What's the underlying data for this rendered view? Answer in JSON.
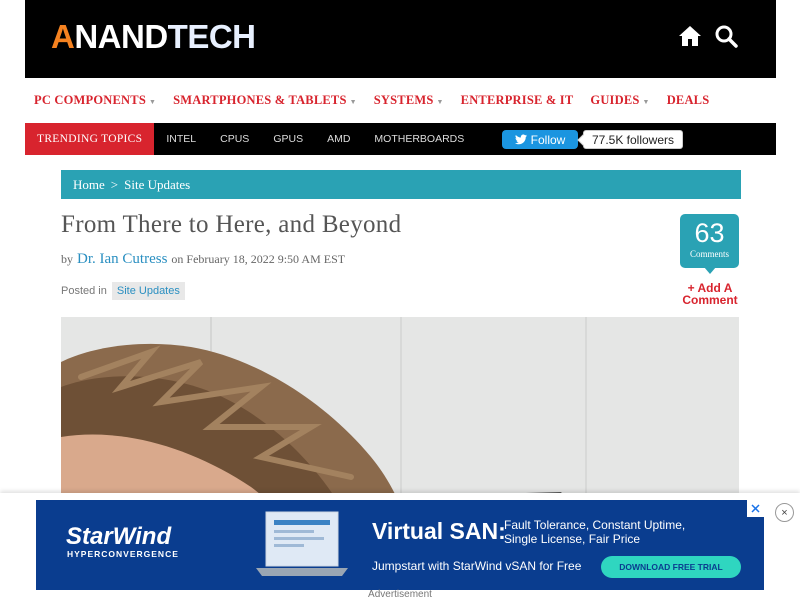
{
  "header": {
    "logo_text": "ANANDTECH",
    "icons": [
      "home-icon",
      "search-icon"
    ]
  },
  "nav": {
    "items": [
      {
        "label": "PC COMPONENTS",
        "dropdown": true
      },
      {
        "label": "SMARTPHONES & TABLETS",
        "dropdown": true
      },
      {
        "label": "SYSTEMS",
        "dropdown": true
      },
      {
        "label": "ENTERPRISE & IT",
        "dropdown": false
      },
      {
        "label": "GUIDES",
        "dropdown": true
      },
      {
        "label": "DEALS",
        "dropdown": false
      }
    ],
    "dropdown_glyph": "▼"
  },
  "trending": {
    "label": "TRENDING TOPICS",
    "items": [
      "INTEL",
      "CPUS",
      "GPUS",
      "AMD",
      "MOTHERBOARDS"
    ],
    "twitter_follow": "Follow",
    "twitter_followers": "77.5K followers"
  },
  "breadcrumb": {
    "home": "Home",
    "separator": ">",
    "section": "Site Updates"
  },
  "article": {
    "title": "From There to Here, and Beyond",
    "by": "by",
    "author": "Dr. Ian Cutress",
    "date": "on February 18, 2022 9:50 AM EST",
    "posted_in": "Posted in",
    "tag": "Site Updates",
    "comment_count": "63",
    "comments_label": "Comments",
    "add_comment_line1": "+ Add A",
    "add_comment_line2": "Comment"
  },
  "ad": {
    "brand": "StarWind",
    "brand_sub": "HYPERCONVERGENCE",
    "headline": "Virtual SAN:",
    "description": "Fault Tolerance, Constant Uptime, Single License, Fair Price",
    "subline": "Jumpstart with StarWind vSAN for Free",
    "cta": "DOWNLOAD FREE TRIAL",
    "caption": "Advertisement",
    "close": "×"
  },
  "colors": {
    "accent_red": "#d8242e",
    "teal": "#2aa2b4",
    "link_blue": "#2a8fc1",
    "ad_blue": "#0a3d8f"
  }
}
